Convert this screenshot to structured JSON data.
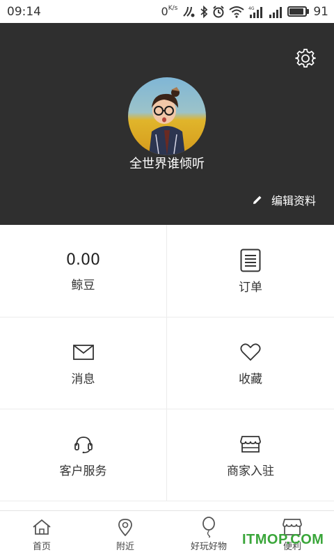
{
  "status_bar": {
    "time": "09:14",
    "net_speed": "0",
    "net_unit": "K/s",
    "battery_level": "91",
    "battery_fraction": 0.91
  },
  "profile": {
    "username": "全世界谁倾听",
    "edit_label": "编辑资料"
  },
  "grid": {
    "balance_value": "0.00",
    "balance_label": "鲸豆",
    "orders_label": "订单",
    "messages_label": "消息",
    "favorites_label": "收藏",
    "support_label": "客户服务",
    "merchant_label": "商家入驻"
  },
  "bottom_nav": {
    "items": [
      {
        "label": "首页",
        "icon": "home-icon"
      },
      {
        "label": "附近",
        "icon": "location-pin-icon"
      },
      {
        "label": "好玩好物",
        "icon": "balloon-icon"
      },
      {
        "label": "便利",
        "icon": "shop-icon"
      }
    ]
  },
  "watermark": "ITMOP.COM",
  "colors": {
    "header_bg": "#2f2f2f",
    "watermark_green": "#3aa63a"
  }
}
